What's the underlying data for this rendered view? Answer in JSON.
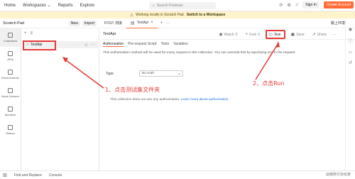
{
  "topbar": {
    "nav": [
      "Home",
      "Workspaces ⌄",
      "Reports",
      "Explore"
    ],
    "search_placeholder": "Search Postman",
    "sign_in": "Sign In",
    "create_account": "Create Account"
  },
  "banner": {
    "text": "Working locally in Scratch Pad.",
    "link": "Switch to a Workspace"
  },
  "sidebar": {
    "title": "Scratch Pad",
    "new_label": "New",
    "import_label": "Import",
    "rail": [
      {
        "label": "Collections",
        "icon": "collections-icon"
      },
      {
        "label": "APIs",
        "icon": "apis-icon"
      },
      {
        "label": "Environments",
        "icon": "environments-icon"
      },
      {
        "label": "Mock Servers",
        "icon": "mock-servers-icon"
      },
      {
        "label": "Monitors",
        "icon": "monitors-icon"
      },
      {
        "label": "History",
        "icon": "history-icon"
      }
    ],
    "collection_name": "TestApi"
  },
  "main": {
    "tabs": [
      {
        "label": "POST 测接"
      },
      {
        "label": "TestApi"
      }
    ],
    "env_label": "搬上环境",
    "title": "TestApi",
    "actions": [
      "Watch",
      "Fork",
      "Run",
      "Save",
      "Share"
    ],
    "action_counts": [
      "0",
      "0"
    ],
    "subtabs": [
      "Authorization",
      "Pre-request Script",
      "Tests",
      "Variables"
    ],
    "description": "This authorization method will be used for every request in this collection. You can override this by specifying one in the request.",
    "type_label": "Type",
    "type_value": "No Auth",
    "no_auth_text": "This collection does not use any authorization.",
    "learn_more": "Learn more about authorization"
  },
  "annotations": {
    "a1": "1、点击测试集文件夹",
    "a2": "2、点击Run"
  },
  "bottom": {
    "find_replace": "Find and Replace",
    "console": "Console",
    "watermark": "@搬砖打杂玩家"
  },
  "colors": {
    "accent": "#ff6c37",
    "annotation": "#e53935",
    "banner": "#fff3cd"
  }
}
